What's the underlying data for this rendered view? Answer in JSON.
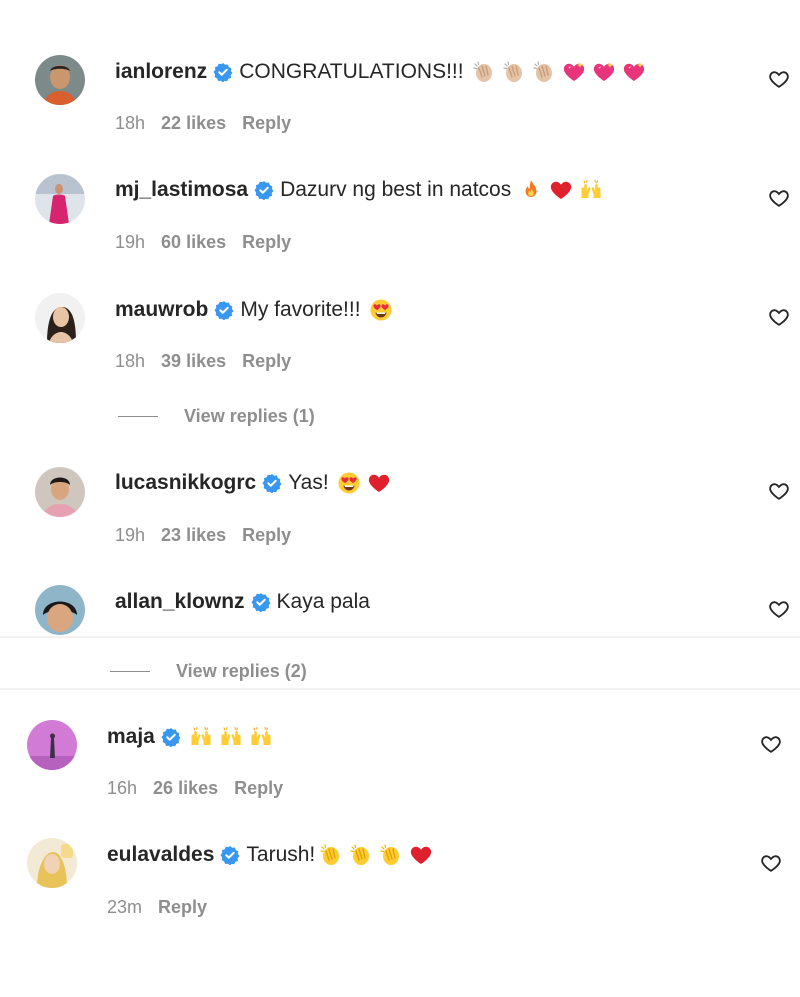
{
  "comments": [
    {
      "username": "ianlorenz",
      "text": "CONGRATULATIONS!!!",
      "emojis": [
        "clap-light",
        "clap-light",
        "clap-light",
        "sparkling-heart",
        "sparkling-heart",
        "sparkling-heart"
      ],
      "time": "18h",
      "likes": "22 likes",
      "reply": "Reply"
    },
    {
      "username": "mj_lastimosa",
      "text": "Dazurv ng best in natcos",
      "emojis": [
        "fire",
        "red-heart",
        "raised-hands"
      ],
      "time": "19h",
      "likes": "60 likes",
      "reply": "Reply"
    },
    {
      "username": "mauwrob",
      "text": "My favorite!!!",
      "emojis": [
        "heart-eyes"
      ],
      "time": "18h",
      "likes": "39 likes",
      "reply": "Reply",
      "view_replies": "View replies (1)"
    },
    {
      "username": "lucasnikkogrc",
      "text": "Yas!",
      "emojis": [
        "heart-eyes",
        "red-heart"
      ],
      "time": "19h",
      "likes": "23 likes",
      "reply": "Reply"
    },
    {
      "username": "allan_klownz",
      "text": "Kaya pala",
      "emojis": [],
      "view_replies": "View replies (2)"
    },
    {
      "username": "maja",
      "text": "",
      "emojis": [
        "raised-hands",
        "raised-hands",
        "raised-hands"
      ],
      "time": "16h",
      "likes": "26 likes",
      "reply": "Reply"
    },
    {
      "username": "eulavaldes",
      "text": "Tarush!",
      "emojis": [
        "clap-yellow",
        "clap-yellow",
        "clap-yellow",
        "red-heart"
      ],
      "time": "23m",
      "reply": "Reply"
    }
  ],
  "icons": {
    "verified": "verified-badge-icon",
    "like": "heart-outline-icon"
  },
  "colors": {
    "text": "#262626",
    "secondary": "#8e8e8e",
    "verified": "#3897f0"
  }
}
